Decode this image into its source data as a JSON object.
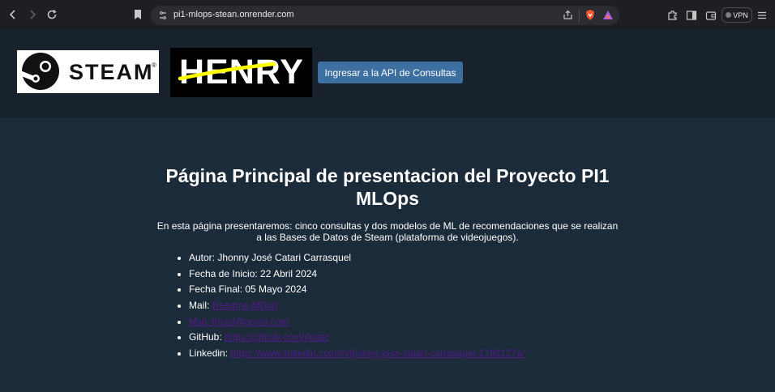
{
  "browser": {
    "url": "pi1-mlops-stean.onrender.com",
    "vpn_label": "VPN"
  },
  "header": {
    "steam_logo_text": "STEAM",
    "steam_reg_mark": "®",
    "henry_logo_text": "HENRY",
    "api_button_label": "Ingresar a la API de Consultas"
  },
  "main": {
    "title": "Página Principal de presentacion del Proyecto PI1 MLOps",
    "intro": "En esta página presentaremos: cinco consultas y dos modelos de ML de recomendaciones que se realizan a las Bases de Datos de Steam (plataforma de videojuegos).",
    "items": [
      {
        "label": "Autor: Jhonny José Catari Carrasquel",
        "link": ""
      },
      {
        "label": "Fecha de Inicio: 22 Abril 2024",
        "link": ""
      },
      {
        "label": "Fecha Final: 05 Mayo 2024",
        "link": ""
      },
      {
        "label": "Mail: ",
        "link": "Readme.MDori"
      },
      {
        "label": "",
        "link": "Mail: jhcati@gmail.com"
      },
      {
        "label": "GitHub: ",
        "link": "https://github.com/jhcatc"
      },
      {
        "label": "Linkedin: ",
        "link": "https://www.linkedin.com/in/jhonny-jose-catari-carrasquel-1792127a/"
      }
    ]
  },
  "colors": {
    "chrome_bg": "#1e1f23",
    "header_bg": "#18222c",
    "page_bg": "#1c2b3a",
    "button_bg": "#3d6fa0",
    "visited_link": "#551a8b",
    "link": "#0000ee"
  }
}
